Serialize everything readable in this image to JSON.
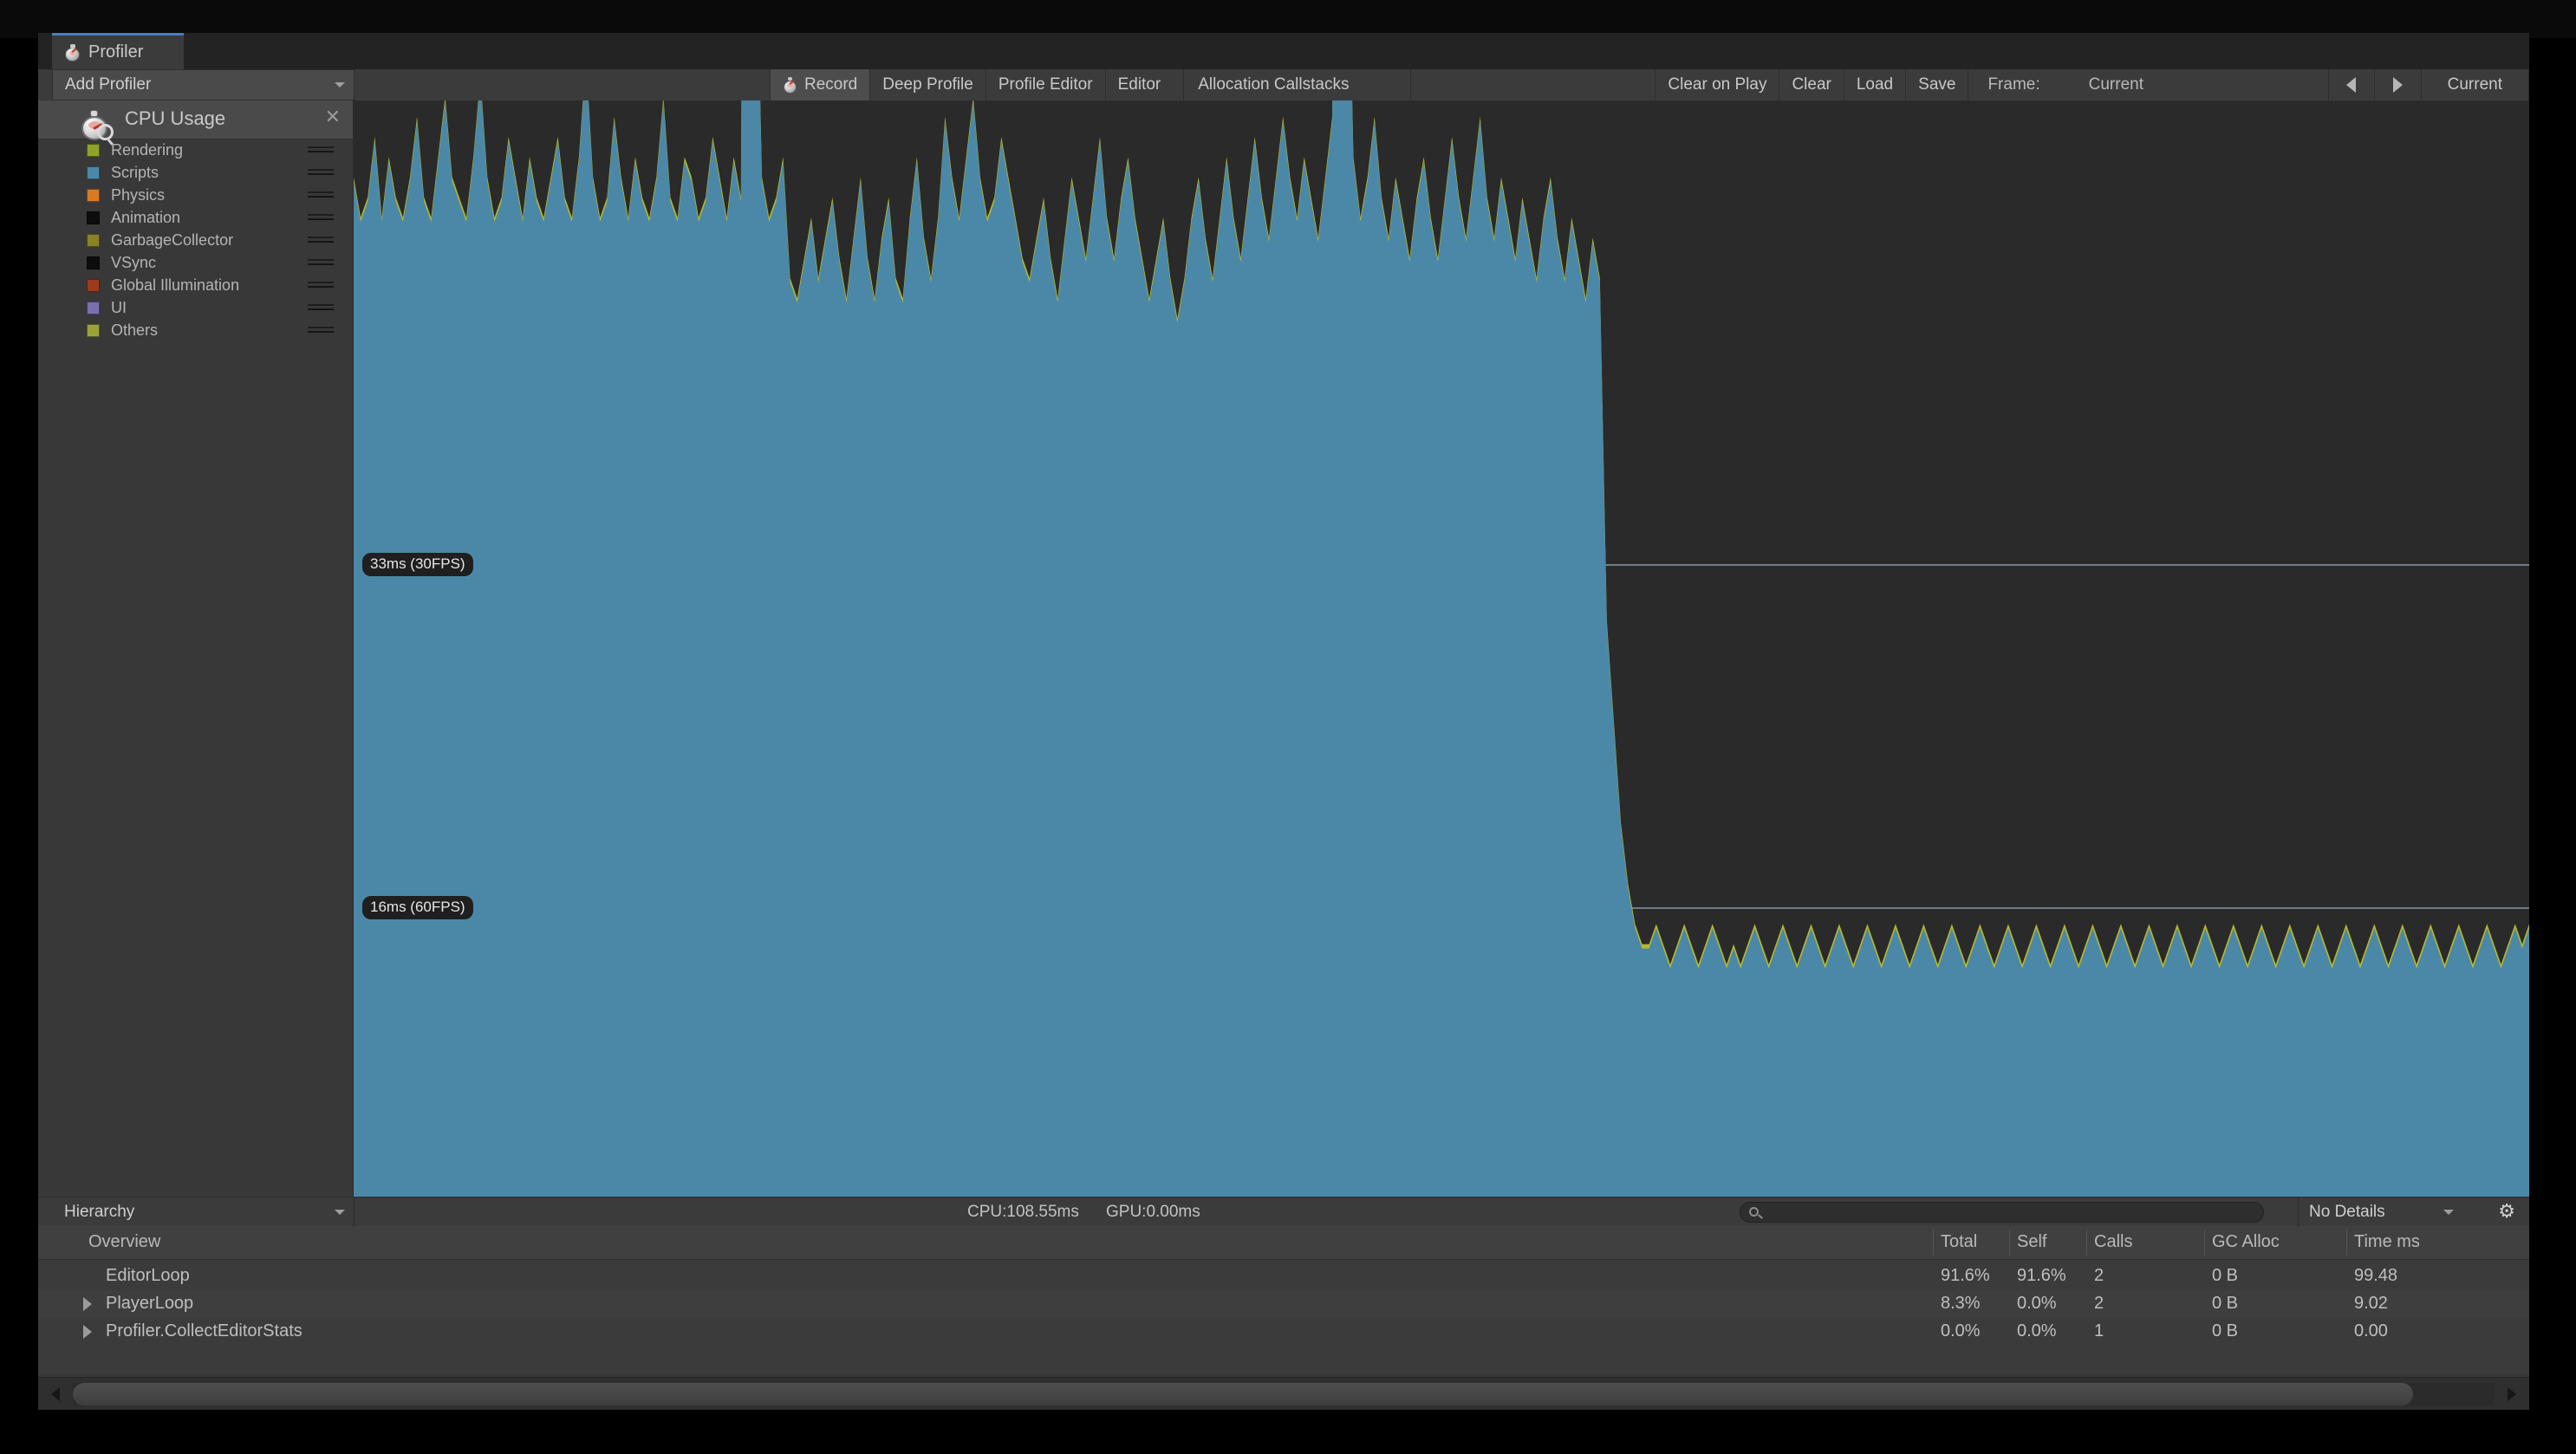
{
  "window": {
    "traffic_lights": [
      "green",
      "yellow",
      "red"
    ],
    "menu_icon": "hamburger-menu-icon"
  },
  "tab": {
    "label": "Profiler",
    "icon": "stopwatch-icon"
  },
  "toolbar": {
    "add_profiler": {
      "label": "Add Profiler",
      "icon": "chevron-down-icon"
    },
    "record": {
      "label": "Record",
      "icon": "record-stopwatch-icon",
      "active": true
    },
    "deep_profile": "Deep Profile",
    "profile_editor": "Profile Editor",
    "target": {
      "label": "Editor",
      "icon": "chevron-down-icon"
    },
    "allocation_callstacks": {
      "label": "Allocation Callstacks",
      "icon": "chevron-down-icon"
    },
    "clear_on_play": "Clear on Play",
    "clear": "Clear",
    "load": "Load",
    "save": "Save",
    "frame_label": "Frame:",
    "frame_value": "Current",
    "prev_frame_icon": "triangle-left-icon",
    "next_frame_icon": "triangle-right-icon",
    "current_button": "Current"
  },
  "module": {
    "icon": "stopwatch-magnifier-icon",
    "title": "CPU Usage",
    "close_icon": "close-icon",
    "legend": [
      {
        "label": "Rendering",
        "color": "#8fa32a"
      },
      {
        "label": "Scripts",
        "color": "#4b88a8"
      },
      {
        "label": "Physics",
        "color": "#d97a23"
      },
      {
        "label": "Animation",
        "color": "#0d0d0d"
      },
      {
        "label": "GarbageCollector",
        "color": "#8a8326"
      },
      {
        "label": "VSync",
        "color": "#0d0d0d"
      },
      {
        "label": "Global Illumination",
        "color": "#9e3a1e"
      },
      {
        "label": "UI",
        "color": "#7a6fb0"
      },
      {
        "label": "Others",
        "color": "#9aa33a"
      }
    ]
  },
  "graph": {
    "markers": [
      {
        "label": "33ms (30FPS)",
        "y": 536
      },
      {
        "label": "16ms (60FPS)",
        "y": 932
      }
    ],
    "bg_color": "#2a2a2a",
    "scripts_color": "#4b88a8",
    "rendering_color": "#b7b72e",
    "gridline_color": "#a9c2cd"
  },
  "chart_data": {
    "type": "area",
    "title": "CPU Usage",
    "ylabel": "ms",
    "gridlines": [
      {
        "value": 33,
        "label": "33ms (30FPS)"
      },
      {
        "value": 16,
        "label": "16ms (60FPS)"
      }
    ],
    "series": [
      {
        "name": "Scripts",
        "color": "#4b88a8"
      },
      {
        "name": "Rendering",
        "color": "#b7b72e"
      }
    ],
    "description": "CPU frame time over ~300 recorded frames. Roughly the first half of the timeline sits far above 33ms (heavy editor load, frames mostly off the top of the chart with two large spikes), then drops sharply near the midpoint to a steady band just under 16ms (60FPS).",
    "values": [
      52,
      50,
      51,
      54,
      50,
      53,
      51,
      50,
      52,
      55,
      51,
      50,
      53,
      56,
      52,
      51,
      50,
      53,
      57,
      52,
      50,
      51,
      54,
      52,
      50,
      53,
      51,
      50,
      52,
      54,
      51,
      50,
      53,
      58,
      52,
      50,
      51,
      55,
      52,
      50,
      53,
      51,
      50,
      52,
      56,
      51,
      50,
      53,
      52,
      50,
      51,
      54,
      52,
      50,
      53,
      51,
      120,
      68,
      52,
      50,
      51,
      53,
      47,
      46,
      48,
      50,
      47,
      49,
      51,
      48,
      46,
      49,
      52,
      48,
      46,
      49,
      51,
      47,
      46,
      50,
      53,
      49,
      47,
      50,
      55,
      52,
      50,
      53,
      56,
      52,
      50,
      51,
      54,
      52,
      50,
      48,
      47,
      49,
      51,
      48,
      46,
      49,
      52,
      50,
      48,
      51,
      54,
      50,
      48,
      51,
      53,
      50,
      48,
      46,
      48,
      50,
      47,
      45,
      47,
      50,
      52,
      49,
      47,
      50,
      53,
      50,
      48,
      51,
      54,
      51,
      49,
      52,
      55,
      52,
      50,
      53,
      51,
      49,
      52,
      55,
      118,
      70,
      53,
      50,
      52,
      55,
      51,
      49,
      52,
      50,
      48,
      51,
      53,
      50,
      48,
      51,
      54,
      51,
      49,
      52,
      55,
      51,
      49,
      52,
      50,
      48,
      51,
      49,
      47,
      50,
      52,
      49,
      47,
      50,
      48,
      46,
      49,
      47,
      30,
      25,
      20,
      17,
      15,
      14,
      14,
      15,
      14,
      13,
      14,
      15,
      14,
      13,
      14,
      15,
      14,
      13,
      14,
      13,
      14,
      15,
      14,
      13,
      14,
      15,
      14,
      13,
      14,
      15,
      14,
      13,
      14,
      15,
      14,
      13,
      14,
      15,
      14,
      13,
      14,
      15,
      14,
      13,
      14,
      15,
      14,
      13,
      14,
      15,
      14,
      13,
      14,
      15,
      14,
      13,
      14,
      15,
      14,
      13,
      14,
      15,
      14,
      13,
      14,
      15,
      14,
      13,
      14,
      15,
      14,
      13,
      14,
      15,
      14,
      13,
      14,
      15,
      14,
      13,
      14,
      15,
      14,
      13,
      14,
      15,
      14,
      13,
      14,
      15,
      14,
      13,
      14,
      15,
      14,
      13,
      14,
      15,
      14,
      13,
      14,
      15,
      14,
      13,
      14,
      15,
      14,
      13,
      14,
      15,
      14,
      13,
      14,
      15,
      14,
      13,
      14,
      15,
      14,
      13,
      14,
      15,
      14,
      13,
      14,
      15,
      14,
      13,
      14,
      15,
      14,
      15
    ]
  },
  "hierarchy_bar": {
    "dropdown": {
      "label": "Hierarchy",
      "icon": "chevron-down-icon"
    },
    "cpu_stat": "CPU:108.55ms",
    "gpu_stat": "GPU:0.00ms",
    "search_placeholder": "",
    "search_value": "",
    "search_icon": "search-icon",
    "details_dropdown": {
      "label": "No Details",
      "icon": "chevron-down-icon"
    },
    "gear_icon": "gear-icon"
  },
  "table": {
    "columns": [
      "Overview",
      "Total",
      "Self",
      "Calls",
      "GC Alloc",
      "Time ms"
    ],
    "rows": [
      {
        "name": "EditorLoop",
        "expandable": false,
        "total": "91.6%",
        "self": "91.6%",
        "calls": "2",
        "gc_alloc": "0 B",
        "time_ms": "99.48"
      },
      {
        "name": "PlayerLoop",
        "expandable": true,
        "total": "8.3%",
        "self": "0.0%",
        "calls": "2",
        "gc_alloc": "0 B",
        "time_ms": "9.02"
      },
      {
        "name": "Profiler.CollectEditorStats",
        "expandable": true,
        "total": "0.0%",
        "self": "0.0%",
        "calls": "1",
        "gc_alloc": "0 B",
        "time_ms": "0.00"
      }
    ]
  },
  "scrollbar": {
    "left_icon": "triangle-left-icon",
    "right_icon": "triangle-right-icon"
  }
}
